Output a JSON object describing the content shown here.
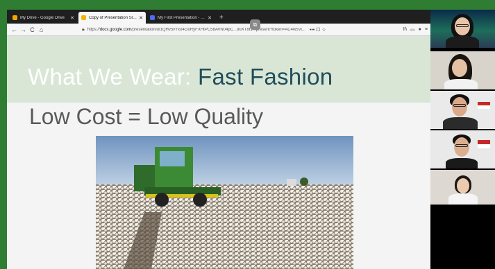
{
  "browser": {
    "tabs": [
      {
        "title": "My Drive - Google Drive",
        "favicon_color": "#f2a600",
        "active": false
      },
      {
        "title": "Copy of Presentation Slides_Fi...",
        "favicon_color": "#f4b400",
        "active": true
      },
      {
        "title": "My First Presentation - Mentim...",
        "favicon_color": "#4a6cf7",
        "active": false
      }
    ],
    "new_tab": "+",
    "url_host": "docs.google.com",
    "url_prefix": "https://",
    "url_rest": "/presentation/d/1QHv5vYxo4GoRyFXHtPC58AVN04pC...9uXT8t14/present?token=AC4w5Vi...",
    "url_more": "••• ☐ ☆",
    "nav": {
      "back": "←",
      "forward": "→",
      "reload": "C",
      "home": "⌂"
    },
    "right_buttons": [
      "II\\",
      "▭",
      "●",
      "≡"
    ]
  },
  "slide": {
    "title_part1": "What We Wear: ",
    "title_part2": "Fast Fashion",
    "subtitle": "Low Cost = Low Quality",
    "image_alt": "cotton harvester in a cotton field"
  },
  "colors": {
    "title_band": "#d9e6d5",
    "title_accent": "#1f4d5c",
    "frame": "#2e7d32"
  },
  "participants": [
    {
      "name": "participant-1"
    },
    {
      "name": "participant-2"
    },
    {
      "name": "participant-3"
    },
    {
      "name": "participant-4"
    },
    {
      "name": "participant-5"
    }
  ]
}
